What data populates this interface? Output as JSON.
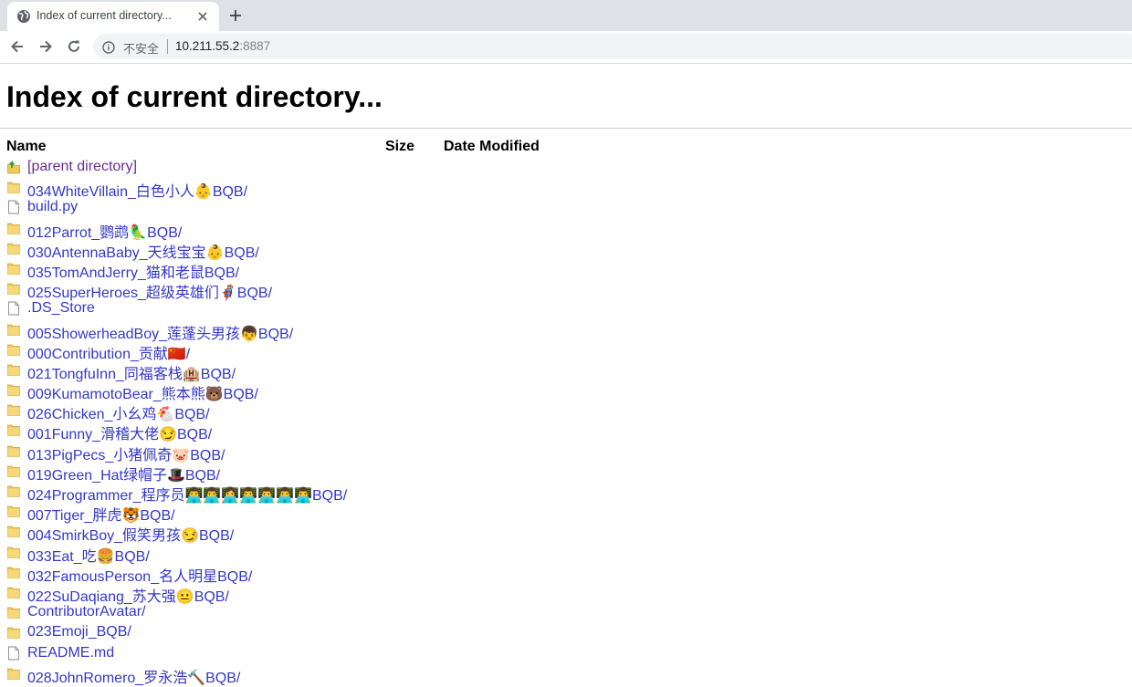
{
  "browser": {
    "tab": {
      "title": "Index of current directory..."
    },
    "address_bar": {
      "security_label": "不安全",
      "url_host": "10.211.55.2",
      "url_port": ":8887"
    }
  },
  "page": {
    "heading": "Index of current directory...",
    "columns": {
      "name": "Name",
      "size": "Size",
      "date": "Date Modified"
    },
    "entries": [
      {
        "name": "[parent directory]",
        "type": "parent",
        "visited": true
      },
      {
        "name": "034WhiteVillain_白色小人👶BQB/",
        "type": "folder"
      },
      {
        "name": "build.py",
        "type": "file"
      },
      {
        "name": "012Parrot_鹦鹉🦜BQB/",
        "type": "folder"
      },
      {
        "name": "030AntennaBaby_天线宝宝👶BQB/",
        "type": "folder"
      },
      {
        "name": "035TomAndJerry_猫和老鼠BQB/",
        "type": "folder"
      },
      {
        "name": "025SuperHeroes_超级英雄们🦸BQB/",
        "type": "folder"
      },
      {
        "name": ".DS_Store",
        "type": "file"
      },
      {
        "name": "005ShowerheadBoy_莲蓬头男孩👦BQB/",
        "type": "folder"
      },
      {
        "name": "000Contribution_贡献🇨🇳/",
        "type": "folder"
      },
      {
        "name": "021TongfuInn_同福客栈🏨BQB/",
        "type": "folder"
      },
      {
        "name": "009KumamotoBear_熊本熊🐻BQB/",
        "type": "folder"
      },
      {
        "name": "026Chicken_小幺鸡🐔BQB/",
        "type": "folder"
      },
      {
        "name": "001Funny_滑稽大佬😏BQB/",
        "type": "folder"
      },
      {
        "name": "013PigPecs_小猪佩奇🐷BQB/",
        "type": "folder"
      },
      {
        "name": "019Green_Hat绿帽子🎩BQB/",
        "type": "folder"
      },
      {
        "name": "024Programmer_程序员👨‍💻👨‍💻👩‍💻👨‍💻👨‍💻👨‍💻👨‍💻BQB/",
        "type": "folder"
      },
      {
        "name": "007Tiger_胖虎🐯BQB/",
        "type": "folder"
      },
      {
        "name": "004SmirkBoy_假笑男孩😏BQB/",
        "type": "folder"
      },
      {
        "name": "033Eat_吃🍔BQB/",
        "type": "folder"
      },
      {
        "name": "032FamousPerson_名人明星BQB/",
        "type": "folder"
      },
      {
        "name": "022SuDaqiang_苏大强😐BQB/",
        "type": "folder"
      },
      {
        "name": "ContributorAvatar/",
        "type": "folder"
      },
      {
        "name": "023Emoji_BQB/",
        "type": "folder"
      },
      {
        "name": "README.md",
        "type": "file"
      },
      {
        "name": "028JohnRomero_罗永浩🔨BQB/",
        "type": "folder"
      }
    ]
  },
  "colors": {
    "link": "#3438c9",
    "visited_link": "#6b2f8e",
    "folder": "#f0c85a"
  },
  "icons": [
    "globe-icon",
    "close-icon",
    "plus-icon",
    "back-arrow-icon",
    "forward-arrow-icon",
    "reload-icon",
    "info-icon",
    "folder-icon",
    "file-icon",
    "parent-up-icon"
  ]
}
